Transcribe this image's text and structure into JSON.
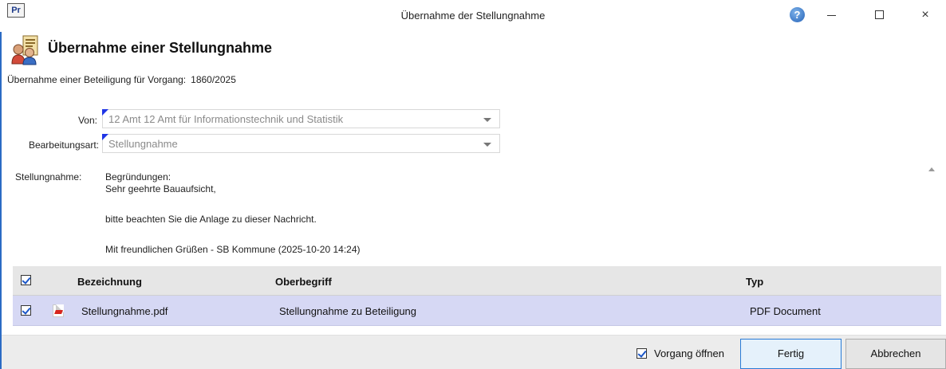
{
  "window": {
    "app_icon_text": "Pr",
    "title": "Übernahme der Stellungnahme",
    "help_icon": "help-icon",
    "minimize_icon": "minimize-icon",
    "maximize_icon": "maximize-icon",
    "close_glyph": "×"
  },
  "dialog": {
    "heading": "Übernahme einer Stellungnahme",
    "subtitle_label": "Übernahme einer Beteiligung für Vorgang:",
    "subtitle_value": "1860/2025"
  },
  "form": {
    "von_label": "Von:",
    "von_value": "12 Amt 12 Amt für Informationstechnik und Statistik",
    "bearbeitungsart_label": "Bearbeitungsart:",
    "bearbeitungsart_value": "Stellungnahme",
    "stellungnahme_label": "Stellungnahme:",
    "stellungnahme_lines": {
      "l1": "Begründungen:",
      "l2": "Sehr geehrte Bauaufsicht,",
      "l3": "bitte beachten Sie die Anlage zu dieser Nachricht.",
      "l4": "Mit freundlichen Grüßen - SB Kommune (2025-10-20 14:24)"
    }
  },
  "grid": {
    "headers": {
      "bezeichnung": "Bezeichnung",
      "oberbegriff": "Oberbegriff",
      "typ": "Typ"
    },
    "rows": [
      {
        "checked": true,
        "bezeichnung": "Stellungnahme.pdf",
        "oberbegriff": "Stellungnahme zu Beteiligung",
        "typ": "PDF Document"
      }
    ]
  },
  "footer": {
    "vorgang_oeffnen_label": "Vorgang öffnen",
    "vorgang_oeffnen_checked": true,
    "fertig_label": "Fertig",
    "abbrechen_label": "Abbrechen"
  },
  "colors": {
    "accent": "#2b6bc4",
    "selected_row": "#d6d8f4",
    "required_marker": "#1f35e6"
  }
}
